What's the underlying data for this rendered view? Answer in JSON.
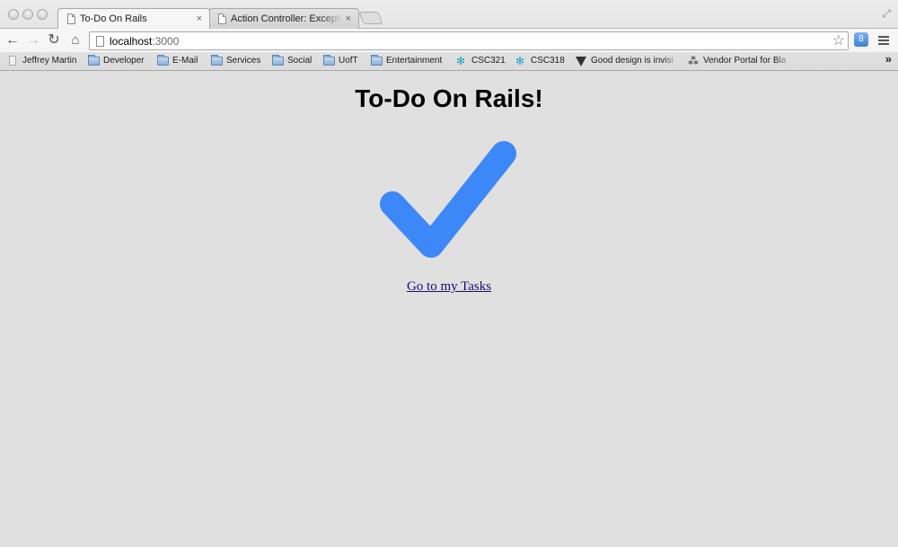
{
  "browser": {
    "tabs": [
      {
        "title": "To-Do On Rails",
        "active": true
      },
      {
        "title": "Action Controller: Exception",
        "active": false
      }
    ],
    "close_glyph": "×",
    "address": {
      "host": "localhost",
      "port": ":3000"
    },
    "bookmarks": [
      {
        "label": "Jeffrey Martin",
        "icon": "page-icon"
      },
      {
        "label": "Developer",
        "icon": "folder-icon"
      },
      {
        "label": "E-Mail",
        "icon": "folder-icon"
      },
      {
        "label": "Services",
        "icon": "folder-icon"
      },
      {
        "label": "Social",
        "icon": "folder-icon"
      },
      {
        "label": "UofT",
        "icon": "folder-icon"
      },
      {
        "label": "Entertainment",
        "icon": "folder-icon"
      },
      {
        "label": "CSC321",
        "icon": "star-logo-icon"
      },
      {
        "label": "CSC318",
        "icon": "star-logo-icon"
      },
      {
        "label": "Good design is invisi",
        "icon": "triangle-logo-icon"
      },
      {
        "label": "Vendor Portal for Bla",
        "icon": "blackberry-icon"
      }
    ],
    "overflow_glyph": "»"
  },
  "page": {
    "title": "To-Do On Rails!",
    "link_text": "Go to my Tasks",
    "checkmark_color": "#3d88f8",
    "background": "#e0e0e0"
  }
}
